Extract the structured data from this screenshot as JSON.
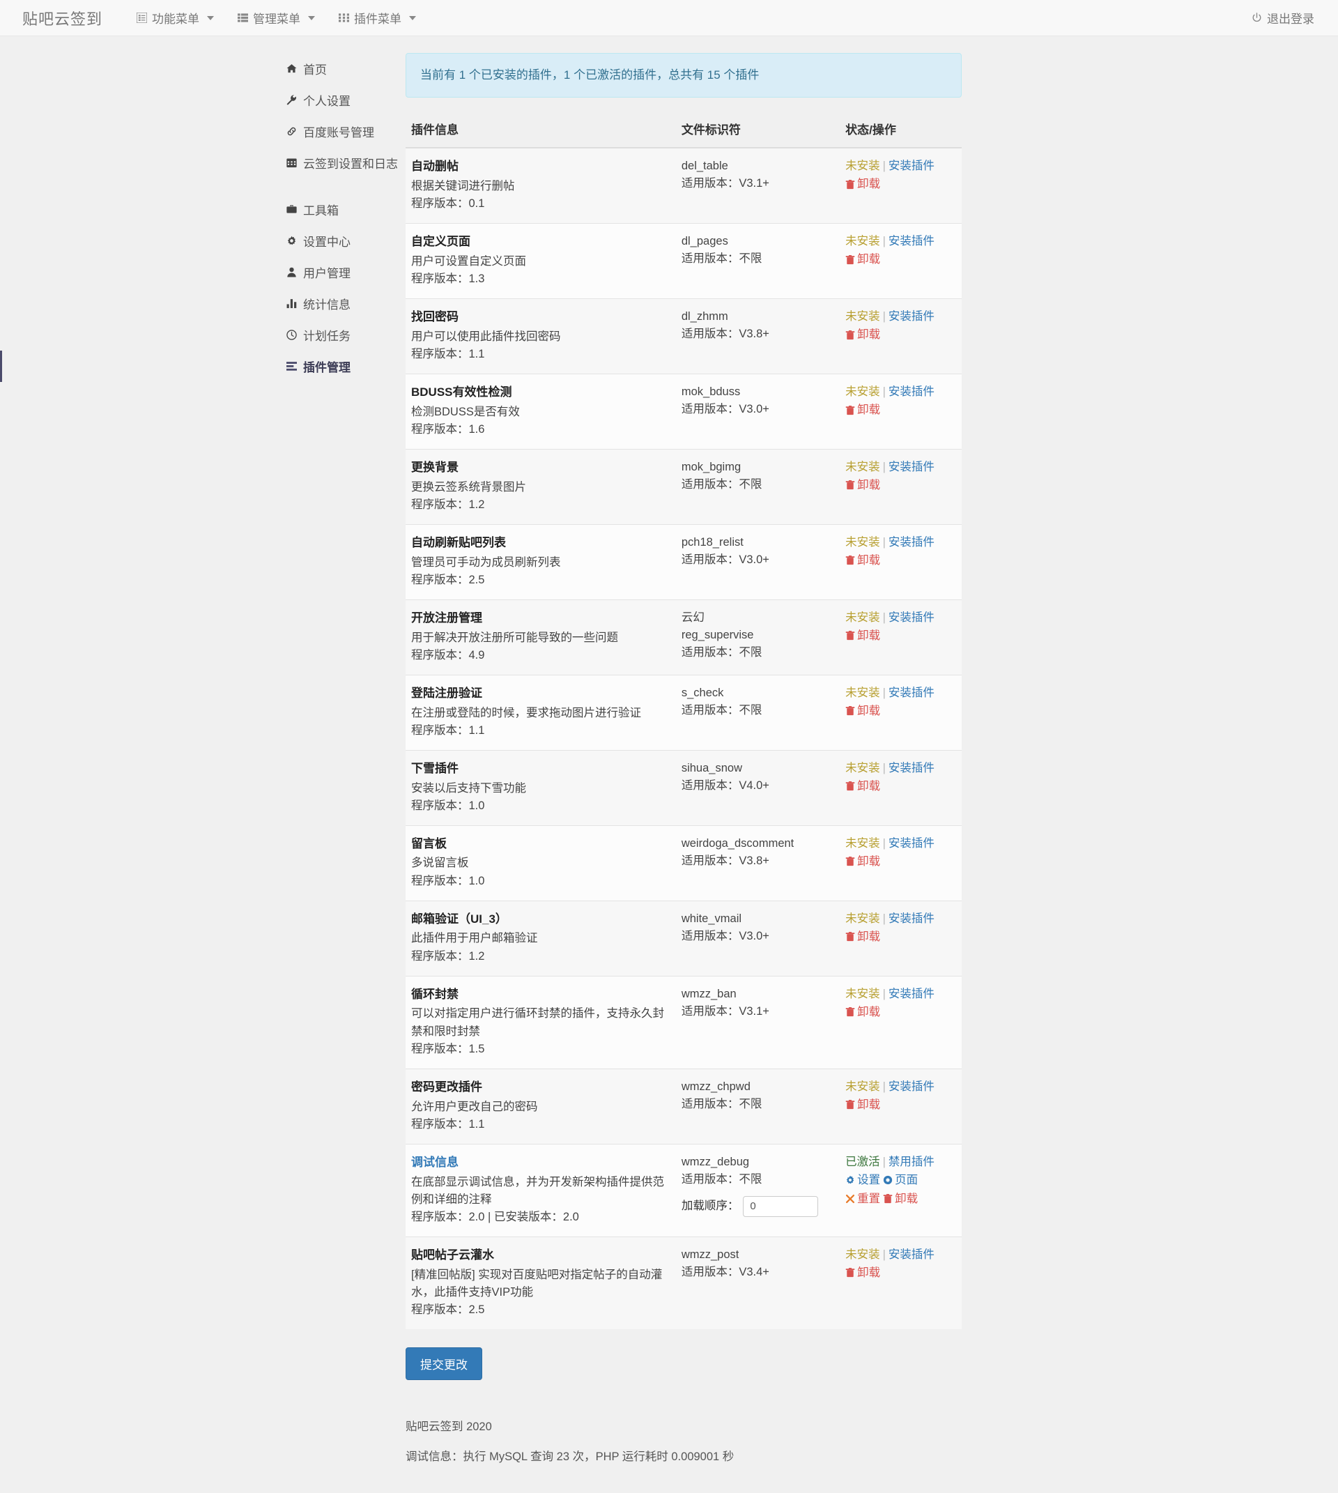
{
  "navbar": {
    "brand": "贴吧云签到",
    "items": [
      {
        "label": "功能菜单",
        "icon": "list-icon",
        "caret": true
      },
      {
        "label": "管理菜单",
        "icon": "th-list-icon",
        "caret": true
      },
      {
        "label": "插件菜单",
        "icon": "th-icon",
        "caret": true
      }
    ],
    "logout": {
      "label": "退出登录",
      "icon": "power-off-icon"
    }
  },
  "sidebar": {
    "groups": [
      {
        "items": [
          {
            "label": "首页",
            "icon": "home-icon",
            "active": false
          },
          {
            "label": "个人设置",
            "icon": "wrench-icon",
            "active": false
          },
          {
            "label": "百度账号管理",
            "icon": "link-icon",
            "active": false
          },
          {
            "label": "云签到设置和日志",
            "icon": "calendar-icon",
            "active": false
          }
        ]
      },
      {
        "items": [
          {
            "label": "工具箱",
            "icon": "briefcase-icon",
            "active": false
          },
          {
            "label": "设置中心",
            "icon": "gear-icon",
            "active": false
          },
          {
            "label": "用户管理",
            "icon": "user-icon",
            "active": false
          },
          {
            "label": "统计信息",
            "icon": "bar-chart-icon",
            "active": false
          },
          {
            "label": "计划任务",
            "icon": "clock-icon",
            "active": false
          },
          {
            "label": "插件管理",
            "icon": "tasks-icon",
            "active": true
          }
        ]
      }
    ]
  },
  "main": {
    "alert": "当前有 1 个已安装的插件，1 个已激活的插件，总共有 15 个插件",
    "table": {
      "headers": [
        "插件信息",
        "文件标识符",
        "状态/操作"
      ],
      "labels": {
        "version_prefix": "程序版本：",
        "installed_version_prefix": "已安装版本：",
        "applicable_prefix": "适用版本：",
        "load_order_label": "加载顺序：",
        "status_not_installed": "未安装",
        "status_activated": "已激活",
        "action_install": "安装插件",
        "action_disable": "禁用插件",
        "action_uninstall": "卸载",
        "action_settings": "设置",
        "action_page": "页面",
        "action_reset": "重置"
      },
      "rows": [
        {
          "title": "自动删帖",
          "title_link": false,
          "desc": "根据关键词进行删帖",
          "version": "0.1",
          "installed_version": "",
          "file_id": "del_table",
          "file_id_extra": "",
          "applicable": "V3.1+",
          "status": "未安装",
          "status_kind": "no",
          "primary_action": "安装插件",
          "load_order": null,
          "extra_actions": false
        },
        {
          "title": "自定义页面",
          "title_link": false,
          "desc": "用户可设置自定义页面",
          "version": "1.3",
          "installed_version": "",
          "file_id": "dl_pages",
          "file_id_extra": "",
          "applicable": "不限",
          "status": "未安装",
          "status_kind": "no",
          "primary_action": "安装插件",
          "load_order": null,
          "extra_actions": false
        },
        {
          "title": "找回密码",
          "title_link": false,
          "desc": "用户可以使用此插件找回密码",
          "version": "1.1",
          "installed_version": "",
          "file_id": "dl_zhmm",
          "file_id_extra": "",
          "applicable": "V3.8+",
          "status": "未安装",
          "status_kind": "no",
          "primary_action": "安装插件",
          "load_order": null,
          "extra_actions": false
        },
        {
          "title": "BDUSS有效性检测",
          "title_link": false,
          "desc": "检测BDUSS是否有效",
          "version": "1.6",
          "installed_version": "",
          "file_id": "mok_bduss",
          "file_id_extra": "",
          "applicable": "V3.0+",
          "status": "未安装",
          "status_kind": "no",
          "primary_action": "安装插件",
          "load_order": null,
          "extra_actions": false
        },
        {
          "title": "更换背景",
          "title_link": false,
          "desc": "更换云签系统背景图片",
          "version": "1.2",
          "installed_version": "",
          "file_id": "mok_bgimg",
          "file_id_extra": "",
          "applicable": "不限",
          "status": "未安装",
          "status_kind": "no",
          "primary_action": "安装插件",
          "load_order": null,
          "extra_actions": false
        },
        {
          "title": "自动刷新贴吧列表",
          "title_link": false,
          "desc": "管理员可手动为成员刷新列表",
          "version": "2.5",
          "installed_version": "",
          "file_id": "pch18_relist",
          "file_id_extra": "",
          "applicable": "V3.0+",
          "status": "未安装",
          "status_kind": "no",
          "primary_action": "安装插件",
          "load_order": null,
          "extra_actions": false
        },
        {
          "title": "开放注册管理",
          "title_link": false,
          "desc": "用于解决开放注册所可能导致的一些问题",
          "version": "4.9",
          "installed_version": "",
          "file_id": "reg_supervise",
          "file_id_extra": "云幻",
          "applicable": "不限",
          "status": "未安装",
          "status_kind": "no",
          "primary_action": "安装插件",
          "load_order": null,
          "extra_actions": false
        },
        {
          "title": "登陆注册验证",
          "title_link": false,
          "desc": "在注册或登陆的时候，要求拖动图片进行验证",
          "version": "1.1",
          "installed_version": "",
          "file_id": "s_check",
          "file_id_extra": "",
          "applicable": "不限",
          "status": "未安装",
          "status_kind": "no",
          "primary_action": "安装插件",
          "load_order": null,
          "extra_actions": false
        },
        {
          "title": "下雪插件",
          "title_link": false,
          "desc": "安装以后支持下雪功能",
          "version": "1.0",
          "installed_version": "",
          "file_id": "sihua_snow",
          "file_id_extra": "",
          "applicable": "V4.0+",
          "status": "未安装",
          "status_kind": "no",
          "primary_action": "安装插件",
          "load_order": null,
          "extra_actions": false
        },
        {
          "title": "留言板",
          "title_link": false,
          "desc": "多说留言板",
          "version": "1.0",
          "installed_version": "",
          "file_id": "weirdoga_dscomment",
          "file_id_extra": "",
          "applicable": "V3.8+",
          "status": "未安装",
          "status_kind": "no",
          "primary_action": "安装插件",
          "load_order": null,
          "extra_actions": false
        },
        {
          "title": "邮箱验证（UI_3）",
          "title_link": false,
          "desc": "此插件用于用户邮箱验证",
          "version": "1.2",
          "installed_version": "",
          "file_id": "white_vmail",
          "file_id_extra": "",
          "applicable": "V3.0+",
          "status": "未安装",
          "status_kind": "no",
          "primary_action": "安装插件",
          "load_order": null,
          "extra_actions": false
        },
        {
          "title": "循环封禁",
          "title_link": false,
          "desc": "可以对指定用户进行循环封禁的插件，支持永久封禁和限时封禁",
          "version": "1.5",
          "installed_version": "",
          "file_id": "wmzz_ban",
          "file_id_extra": "",
          "applicable": "V3.1+",
          "status": "未安装",
          "status_kind": "no",
          "primary_action": "安装插件",
          "load_order": null,
          "extra_actions": false
        },
        {
          "title": "密码更改插件",
          "title_link": false,
          "desc": "允许用户更改自己的密码",
          "version": "1.1",
          "installed_version": "",
          "file_id": "wmzz_chpwd",
          "file_id_extra": "",
          "applicable": "不限",
          "status": "未安装",
          "status_kind": "no",
          "primary_action": "安装插件",
          "load_order": null,
          "extra_actions": false
        },
        {
          "title": "调试信息",
          "title_link": true,
          "desc": "在底部显示调试信息，并为开发新架构插件提供范例和详细的注释",
          "version": "2.0",
          "installed_version": "2.0",
          "file_id": "wmzz_debug",
          "file_id_extra": "",
          "applicable": "不限",
          "status": "已激活",
          "status_kind": "yes",
          "primary_action": "禁用插件",
          "load_order": "0",
          "extra_actions": true
        },
        {
          "title": "贴吧帖子云灌水",
          "title_link": false,
          "desc": "[精准回帖版] 实现对百度贴吧对指定帖子的自动灌水，此插件支持VIP功能",
          "version": "2.5",
          "installed_version": "",
          "file_id": "wmzz_post",
          "file_id_extra": "",
          "applicable": "V3.4+",
          "status": "未安装",
          "status_kind": "no",
          "primary_action": "安装插件",
          "load_order": null,
          "extra_actions": false
        }
      ]
    },
    "submit_button": "提交更改"
  },
  "footer": {
    "copyright": "贴吧云签到 2020",
    "debug": "调试信息：执行 MySQL 查询 23 次，PHP 运行耗时 0.009001 秒"
  },
  "colors": {
    "alert_bg": "#d9edf7",
    "alert_text": "#31708f",
    "link": "#337ab7",
    "not_installed": "#b8a032",
    "activated": "#3c763d",
    "danger": "#d9534f",
    "primary_button": "#337ab7"
  }
}
